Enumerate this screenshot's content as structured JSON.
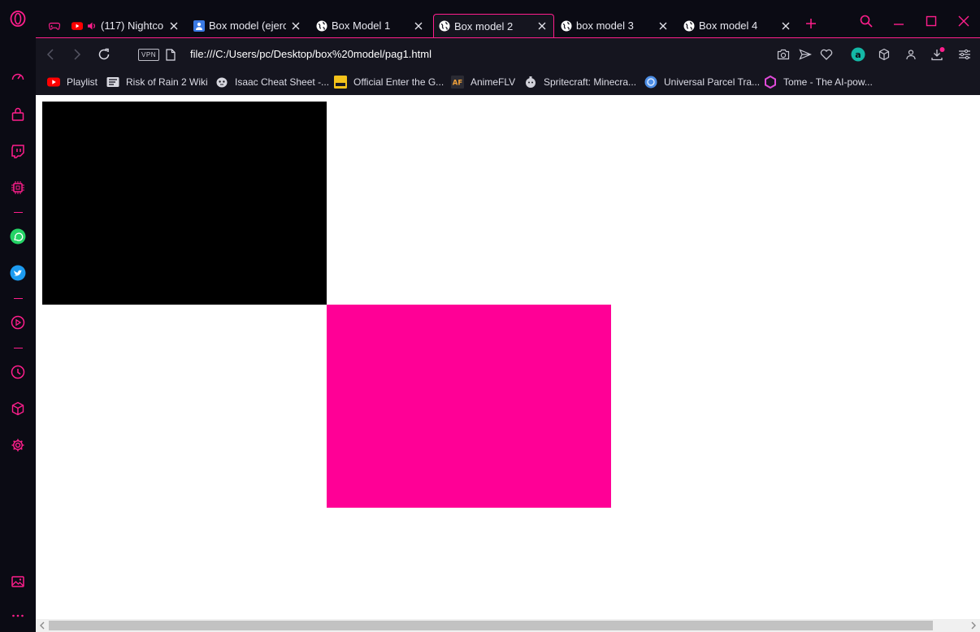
{
  "tabs": [
    {
      "title": "(117) Nightcor",
      "favicon": "youtube-icon",
      "audio": true
    },
    {
      "title": "Box model (ejercic",
      "favicon": "classroom-icon"
    },
    {
      "title": "Box Model 1",
      "favicon": "globe-icon"
    },
    {
      "title": "Box model 2",
      "favicon": "globe-icon",
      "active": true
    },
    {
      "title": "box model 3",
      "favicon": "globe-icon"
    },
    {
      "title": "Box model 4",
      "favicon": "globe-icon"
    }
  ],
  "address_bar": {
    "vpn_label": "VPN",
    "url": "file:///C:/Users/pc/Desktop/box%20model/pag1.html"
  },
  "bookmarks": [
    {
      "label": "Playlist",
      "icon": "youtube-icon"
    },
    {
      "label": "Risk of Rain 2 Wiki",
      "icon": "wiki-icon"
    },
    {
      "label": "Isaac Cheat Sheet -...",
      "icon": "isaac-icon"
    },
    {
      "label": "Official Enter the G...",
      "icon": "gungeon-icon"
    },
    {
      "label": "AnimeFLV",
      "icon": "animeflv-icon"
    },
    {
      "label": "Spritecraft: Minecra...",
      "icon": "spritecraft-icon"
    },
    {
      "label": "Universal Parcel Tra...",
      "icon": "parcel-icon"
    },
    {
      "label": "Tome - The AI-pow...",
      "icon": "tome-icon"
    }
  ],
  "page": {
    "box1_color": "#000000",
    "box2_color": "#ff0096"
  },
  "colors": {
    "accent": "#ff1e8c",
    "chrome_dark": "#0b0b14",
    "chrome_mid": "#15151f"
  }
}
